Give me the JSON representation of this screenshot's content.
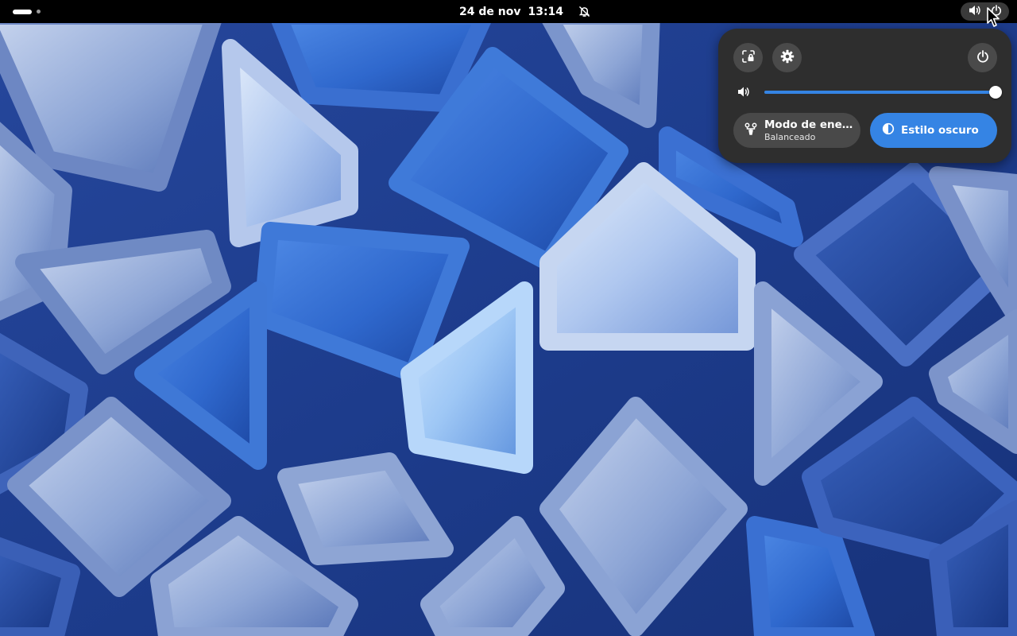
{
  "topbar": {
    "workspaces": {
      "count": 2,
      "active_index": 0
    },
    "clock": {
      "date": "24 de nov",
      "time": "13:14"
    },
    "dnd_icon": "bell-off-icon",
    "indicators": [
      "speaker-icon",
      "power-icon"
    ]
  },
  "quick_settings": {
    "screenshot_icon": "screenshot-icon",
    "settings_icon": "gear-icon",
    "power_icon": "power-icon",
    "volume": {
      "icon": "speaker-icon",
      "level": 1.0
    },
    "power_mode": {
      "title": "Modo de energía",
      "subtitle": "Balanceado",
      "icon": "power-profile-icon",
      "active": false
    },
    "dark_style": {
      "title": "Estilo oscuro",
      "icon": "dark-mode-icon",
      "active": true
    }
  },
  "colors": {
    "accent": "#3584e4",
    "panel_bg": "#2e2e2e",
    "button_bg": "#4a4a4a",
    "topbar_bg": "#000000"
  }
}
